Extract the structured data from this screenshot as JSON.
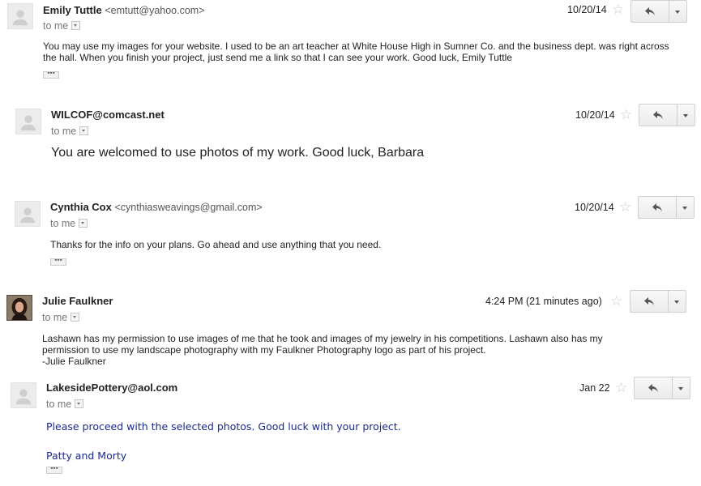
{
  "messages": [
    {
      "sender_name": "Emily Tuttle",
      "sender_email": "<emtutt@yahoo.com>",
      "to": "to me",
      "date": "10/20/14",
      "body": "You may use my images for your website. I used to be an art teacher at White House High in Sumner Co. and the business dept. was right across the hall. When you finish your project, just send me a link so that I can see your work. Good luck, Emily Tuttle",
      "has_trimmed_content": true,
      "avatar": "default-avatar-icon"
    },
    {
      "sender_name": "WILCOF@comcast.net",
      "sender_email": "",
      "to": "to me",
      "date": "10/20/14",
      "body": "You are welcomed to use photos of my work.  Good luck, Barbara",
      "has_trimmed_content": false,
      "avatar": "default-avatar-icon"
    },
    {
      "sender_name": "Cynthia Cox",
      "sender_email": "<cynthiasweavings@gmail.com>",
      "to": "to me",
      "date": "10/20/14",
      "body": "Thanks for the info on your plans. Go ahead and use anything that you need.",
      "has_trimmed_content": true,
      "avatar": "default-avatar-icon"
    },
    {
      "sender_name": "Julie Faulkner",
      "sender_email": "",
      "to": "to me",
      "date": "4:24 PM (21 minutes ago)",
      "body_lines": [
        "Lashawn has my permission to use images of me that he took and images of my jewelry in his competitions. Lashawn also has my",
        "permission to use my landscape photography with my Faulkner Photography logo as part of his project.",
        "-Julie Faulkner"
      ],
      "has_trimmed_content": false,
      "avatar": "profile-photo"
    },
    {
      "sender_name": "LakesidePottery@aol.com",
      "sender_email": "",
      "to": "to me",
      "date": "Jan 22",
      "body_lines": [
        "Please proceed with the selected photos.  Good luck with your project.",
        "Patty and Morty"
      ],
      "has_trimmed_content": true,
      "avatar": "default-avatar-icon"
    }
  ],
  "icons": {
    "star": "star-icon",
    "reply": "reply-icon",
    "more": "chevron-down-icon",
    "trimmed": "ellipsis-icon"
  },
  "trimmed_label": "•••",
  "colors": {
    "body_text": "#222222",
    "meta_text": "#777777",
    "comic_text": "#1b2a8a"
  }
}
